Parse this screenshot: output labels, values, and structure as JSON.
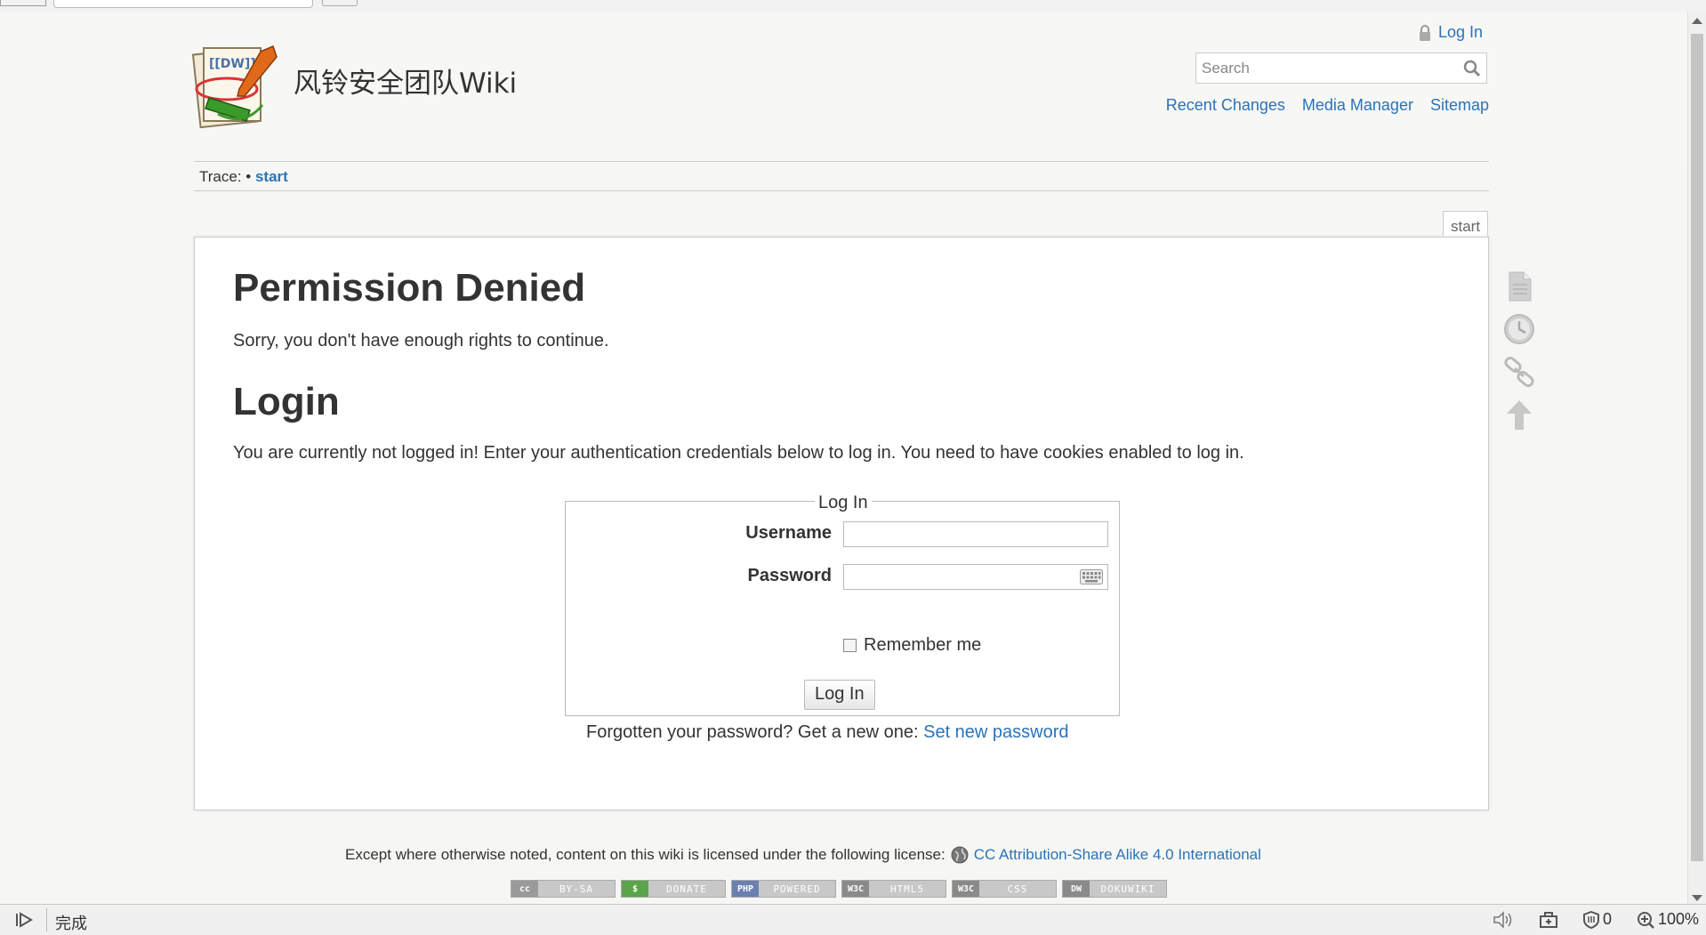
{
  "site": {
    "title": "风铃安全团队Wiki"
  },
  "user_tools": {
    "login": "Log In"
  },
  "search": {
    "placeholder": "Search"
  },
  "site_tools": [
    "Recent Changes",
    "Media Manager",
    "Sitemap"
  ],
  "breadcrumb": {
    "label": "Trace:",
    "bullet": "•",
    "page": "start"
  },
  "page_id": "start",
  "content": {
    "heading1": "Permission Denied",
    "para1": "Sorry, you don't have enough rights to continue.",
    "heading2": "Login",
    "para2": "You are currently not logged in! Enter your authentication credentials below to log in. You need to have cookies enabled to log in."
  },
  "login_form": {
    "legend": "Log In",
    "username_label": "Username",
    "password_label": "Password",
    "remember_label": "Remember me",
    "submit_label": "Log In",
    "forgot_text": "Forgotten your password? Get a new one:",
    "forgot_link": "Set new password"
  },
  "footer": {
    "license_text": "Except where otherwise noted, content on this wiki is licensed under the following license:",
    "license_link": "CC Attribution-Share Alike 4.0 International",
    "badges": [
      {
        "left": "cc",
        "right": "BY-SA",
        "color": "#9a9a9a"
      },
      {
        "left": "$",
        "right": "DONATE",
        "color": "#5aa54a"
      },
      {
        "left": "PHP",
        "right": "POWERED",
        "color": "#6b7fb0"
      },
      {
        "left": "W3C",
        "right": "HTML5",
        "color": "#8a8a8a"
      },
      {
        "left": "W3C",
        "right": "CSS",
        "color": "#8a8a8a"
      },
      {
        "left": "DW",
        "right": "DOKUWIKI",
        "color": "#8a8a8a"
      }
    ]
  },
  "statusbar": {
    "status": "完成",
    "count": "0",
    "zoom": "100%"
  }
}
